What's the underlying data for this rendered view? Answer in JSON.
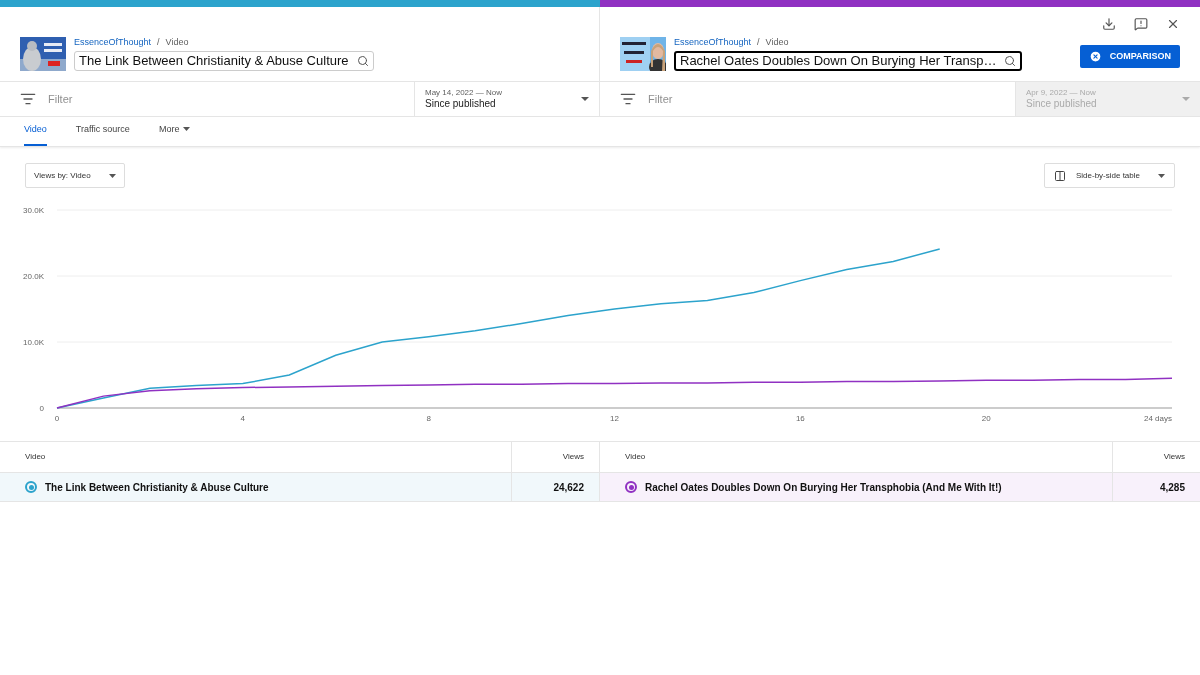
{
  "panels": [
    {
      "color": "#2ca3cc",
      "channel": "EssenceOfThought",
      "crumb": "Video",
      "title": "The Link Between Christianity & Abuse Culture",
      "focused": false,
      "filter_placeholder": "Filter",
      "date_range": "May 14, 2022 — Now",
      "period": "Since published",
      "disabled": false
    },
    {
      "color": "#9031c2",
      "channel": "EssenceOfThought",
      "crumb": "Video",
      "title": "Rachel Oates Doubles Down On Burying Her Transp…",
      "focused": true,
      "filter_placeholder": "Filter",
      "date_range": "Apr 9, 2022 — Now",
      "period": "Since published",
      "disabled": true
    }
  ],
  "breadcrumb_separator": "/",
  "comparison_button": "COMPARISON",
  "tabs": [
    {
      "label": "Video",
      "selected": true,
      "kind": "tab"
    },
    {
      "label": "Traffic source",
      "selected": false,
      "kind": "tab"
    },
    {
      "label": "More",
      "selected": false,
      "kind": "menu"
    }
  ],
  "views_by": "Views by: Video",
  "table_type": "Side-by-side table",
  "chart_data": {
    "type": "line",
    "x": [
      0,
      1,
      2,
      3,
      4,
      5,
      6,
      7,
      8,
      9,
      10,
      11,
      12,
      13,
      14,
      15,
      16,
      17,
      18,
      19,
      20,
      21,
      22,
      23,
      24
    ],
    "xlim": [
      0,
      24
    ],
    "series": [
      {
        "color": "#2ca3cc",
        "values": [
          0,
          1500,
          3000,
          3400,
          3700,
          5000,
          8000,
          10000,
          10800,
          11700,
          12800,
          14000,
          15000,
          15800,
          16300,
          17500,
          19300,
          21000,
          22200,
          24100,
          null,
          null,
          null,
          null,
          null
        ]
      },
      {
        "color": "#9031c2",
        "values": [
          0,
          1800,
          2600,
          2900,
          3100,
          3200,
          3300,
          3400,
          3500,
          3600,
          3600,
          3700,
          3700,
          3800,
          3800,
          3900,
          3900,
          4000,
          4000,
          4100,
          4200,
          4200,
          4300,
          4300,
          4500
        ]
      }
    ],
    "ylim": [
      0,
      30000
    ],
    "yticks": [
      {
        "value": 0,
        "label": "0"
      },
      {
        "value": 10000,
        "label": "10.0K"
      },
      {
        "value": 20000,
        "label": "20.0K"
      },
      {
        "value": 30000,
        "label": "30.0K"
      }
    ],
    "xticks": [
      {
        "value": 0,
        "label": "0"
      },
      {
        "value": 4,
        "label": "4"
      },
      {
        "value": 8,
        "label": "8"
      },
      {
        "value": 12,
        "label": "12"
      },
      {
        "value": 16,
        "label": "16"
      },
      {
        "value": 20,
        "label": "20"
      },
      {
        "value": 24,
        "label": "24 days"
      }
    ]
  },
  "tables": [
    {
      "columns": [
        "Video",
        "Views"
      ],
      "row": {
        "video": "The Link Between Christianity & Abuse Culture",
        "views": "24,622",
        "color": "#2ca3cc"
      }
    },
    {
      "columns": [
        "Video",
        "Views"
      ],
      "row": {
        "video": "Rachel Oates Doubles Down On Burying Her Transphobia (And Me With It!)",
        "views": "4,285",
        "color": "#9031c2"
      }
    }
  ]
}
